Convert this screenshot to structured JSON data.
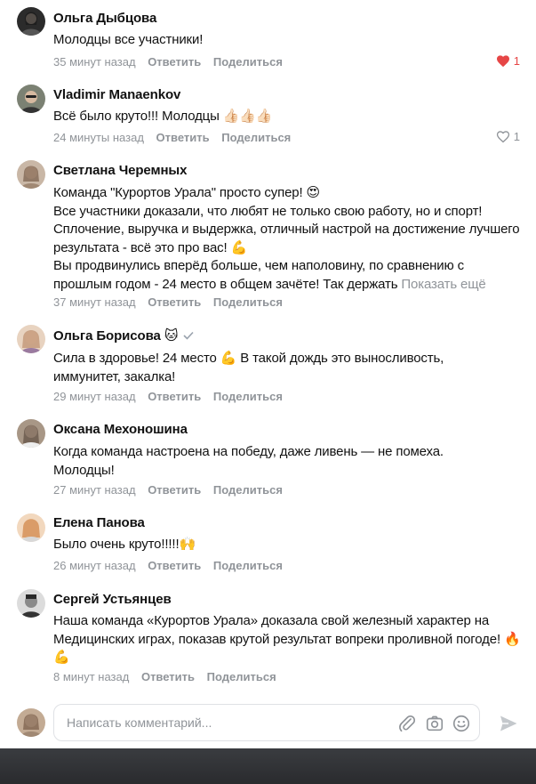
{
  "comments": [
    {
      "author": "Ольга Дыбцова",
      "text": "Молодцы все участники!",
      "time": "35 минут назад",
      "reply": "Ответить",
      "share": "Поделиться",
      "likes": "1",
      "liked": true,
      "avatar_color": "#4a4a4a"
    },
    {
      "author": "Vladimir Manaenkov",
      "text": "Всё было круто!!! Молодцы 👍🏻👍🏻👍🏻",
      "time": "24 минуты назад",
      "reply": "Ответить",
      "share": "Поделиться",
      "likes": "1",
      "liked": false,
      "avatar_color": "#6a6f63"
    },
    {
      "author": "Светлана Черемных",
      "line1": "Команда \"Курортов Урала\" просто супер! 😍",
      "line2": "Все участники доказали, что любят не только свою работу, но и спорт!",
      "line3": "Сплочение, выручка и выдержка, отличный настрой на достижение лучшего результата - всё это про вас! 💪",
      "line4": "Вы продвинулись вперёд больше, чем наполовину, по сравнению с прошлым годом - 24 место в общем зачёте! Так держать",
      "show_more": "Показать ещё",
      "time": "37 минут назад",
      "reply": "Ответить",
      "share": "Поделиться",
      "avatar_color": "#b39a86"
    },
    {
      "author": "Ольга Борисова",
      "author_emoji": "🐱",
      "text": "Сила в здоровье! 24 место 💪 В такой дождь это выносливость, иммунитет, закалка!",
      "time": "29 минут назад",
      "reply": "Ответить",
      "share": "Поделиться",
      "avatar_color": "#c9a37f"
    },
    {
      "author": "Оксана Мехоношина",
      "text": "Когда команда настроена на победу, даже ливень — не помеха. Молодцы!",
      "time": "27 минут назад",
      "reply": "Ответить",
      "share": "Поделиться",
      "avatar_color": "#8c7a6b"
    },
    {
      "author": "Елена Панова",
      "text": "Было очень круто!!!!!🙌",
      "time": "26 минут назад",
      "reply": "Ответить",
      "share": "Поделиться",
      "avatar_color": "#d9a36c"
    },
    {
      "author": "Сергей Устьянцев",
      "text": "Наша команда «Курортов Урала» доказала свой железный характер на Медицинских играх, показав крутой результат вопреки проливной погоде! 🔥💪",
      "time": "8 минут назад",
      "reply": "Ответить",
      "share": "Поделиться",
      "avatar_color": "#3d3d3d"
    }
  ],
  "composer": {
    "placeholder": "Написать комментарий..."
  },
  "colors": {
    "like_red": "#e64646",
    "muted": "#909499",
    "accent_send": "#c4c8cc"
  }
}
